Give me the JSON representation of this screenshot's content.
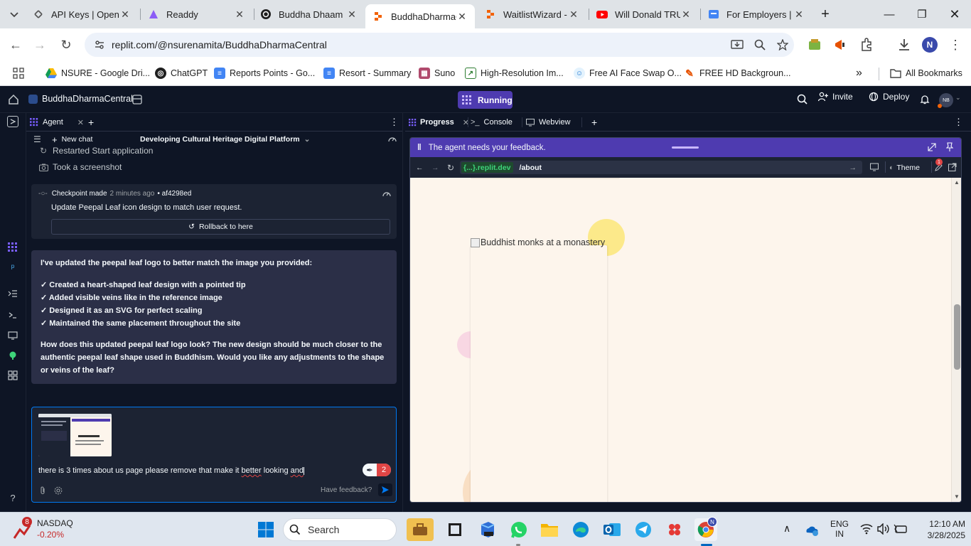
{
  "browser": {
    "tabs": [
      {
        "title": "API Keys | OpenA",
        "icon": "openai-icon"
      },
      {
        "title": "Readdy",
        "icon": "readdy-icon"
      },
      {
        "title": "Buddha Dhaam",
        "icon": "chatgpt-icon"
      },
      {
        "title": "BuddhaDharmaC",
        "icon": "replit-icon",
        "active": true
      },
      {
        "title": "WaitlistWizard -",
        "icon": "replit-icon"
      },
      {
        "title": "Will Donald TRU",
        "icon": "youtube-icon"
      },
      {
        "title": "For Employers | C",
        "icon": "employer-icon"
      }
    ],
    "url": "replit.com/@nsurenamita/BuddhaDharmaCentral",
    "profile_initial": "N",
    "bookmarks": [
      {
        "label": "NSURE - Google Dri..."
      },
      {
        "label": "ChatGPT"
      },
      {
        "label": "Reports Points - Go..."
      },
      {
        "label": "Resort - Summary"
      },
      {
        "label": "Suno"
      },
      {
        "label": "High-Resolution Im..."
      },
      {
        "label": "Free AI Face Swap O..."
      },
      {
        "label": "FREE HD Backgroun..."
      }
    ],
    "all_bookmarks": "All Bookmarks"
  },
  "replit": {
    "project_name": "BuddhaDharmaCentral",
    "run_status": "Running",
    "invite": "Invite",
    "deploy": "Deploy",
    "avatar_initials": "NB"
  },
  "agent": {
    "tab_label": "Agent",
    "new_chat": "New chat",
    "chat_title": "Developing Cultural Heritage Digital Platform",
    "log": [
      {
        "text": "Restarted Start application"
      },
      {
        "text": "Took a screenshot"
      }
    ],
    "checkpoint": {
      "label": "Checkpoint made",
      "time": "2 minutes ago",
      "hash": "• af4298ed",
      "description": "Update Peepal Leaf icon design to match user request.",
      "rollback": "Rollback to here"
    },
    "message": {
      "intro": "I've updated the peepal leaf logo to better match the image you provided:",
      "bullets": [
        "✓ Created a heart-shaped leaf design with a pointed tip",
        "✓ Added visible veins like in the reference image",
        "✓ Designed it as an SVG for perfect scaling",
        "✓ Maintained the same placement throughout the site"
      ],
      "question": "How does this updated peepal leaf logo look? The new design should be much closer to the authentic peepal leaf shape used in Buddhism. Would you like any adjustments to the shape or veins of the leaf?"
    },
    "input": {
      "before": "there is 3 times about us page please remove that make it ",
      "err1": "better",
      "mid": " looking ",
      "err2": "and",
      "grammar_count": "2",
      "feedback_link": "Have feedback?"
    }
  },
  "right": {
    "tabs": [
      {
        "label": "Progress"
      },
      {
        "label": "Console"
      },
      {
        "label": "Webview"
      }
    ],
    "banner": "The agent needs your feedback.",
    "webview": {
      "domain": "{...}.replit.dev",
      "path": "/about",
      "theme": "Theme",
      "badge": "1",
      "image_alt": "Buddhist monks at a monastery"
    }
  },
  "taskbar": {
    "ticker": "NASDAQ",
    "ticker_change": "-0.20%",
    "ticker_badge": "8",
    "search": "Search",
    "lang": "ENG",
    "region": "IN",
    "time": "12:10 AM",
    "date": "3/28/2025",
    "chrome_profile": "N"
  },
  "colors": {
    "replit_bg": "#0e1525",
    "panel": "#1c2333",
    "accent_purple": "#4e3bb0",
    "accent_blue": "#0079f2",
    "site_bg": "#fdf5ec"
  }
}
